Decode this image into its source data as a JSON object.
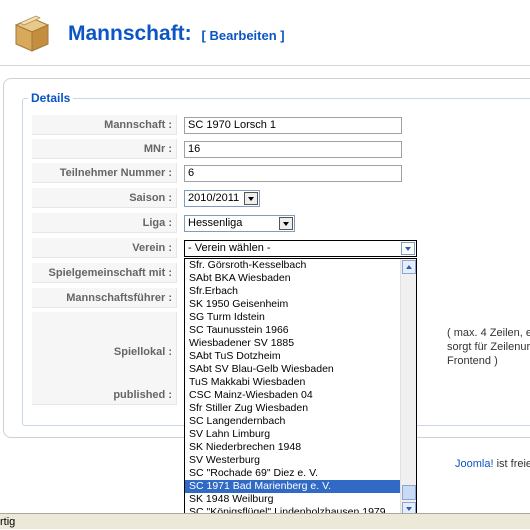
{
  "header": {
    "title": "Mannschaft:",
    "action": "[ Bearbeiten ]"
  },
  "details": {
    "legend": "Details",
    "fields": {
      "mannschaft": {
        "label": "Mannschaft :",
        "value": "SC 1970 Lorsch 1"
      },
      "mnr": {
        "label": "MNr :",
        "value": "16"
      },
      "teilnehmer": {
        "label": "Teilnehmer Nummer :",
        "value": "6"
      },
      "saison": {
        "label": "Saison :",
        "value": "2010/2011"
      },
      "liga": {
        "label": "Liga :",
        "value": "Hessenliga"
      },
      "verein": {
        "label": "Verein :",
        "value": "- Verein wählen -"
      },
      "spielgemeinschaft": {
        "label": "Spielgemeinschaft mit :"
      },
      "mannschaftsfuehrer": {
        "label": "Mannschaftsführer :"
      },
      "spiellokal": {
        "label": "Spiellokal :"
      },
      "published": {
        "label": "published :"
      }
    },
    "hint": {
      "line1": "( max. 4 Zeilen, e",
      "line2": "sorgt für Zeilenur",
      "line3": "Frontend )"
    }
  },
  "dropdown": {
    "items": [
      "Sfr. Görsroth-Kesselbach",
      "SAbt BKA Wiesbaden",
      "Sfr.Erbach",
      "SK 1950 Geisenheim",
      "SG Turm Idstein",
      "SC Taunusstein 1966",
      "Wiesbadener SV 1885",
      "SAbt TuS Dotzheim",
      "SAbt SV Blau-Gelb Wiesbaden",
      "TuS Makkabi Wiesbaden",
      "CSC Mainz-Wiesbaden 04",
      "Sfr Stiller Zug Wiesbaden",
      "SC Langendernbach",
      "SV Lahn Limburg",
      "SK Niederbrechen 1948",
      "SV Westerburg",
      "SC \"Rochade 69\" Diez e. V.",
      "SC 1971 Bad Marienberg e. V.",
      "SK 1948 Weilburg",
      "SC \"Königsflügel\" Lindenholzhausen 1979"
    ],
    "selected_index": 17
  },
  "footer": {
    "link": "Joomla!",
    "text": " ist freie"
  },
  "statusbar": {
    "text": "rtig"
  }
}
